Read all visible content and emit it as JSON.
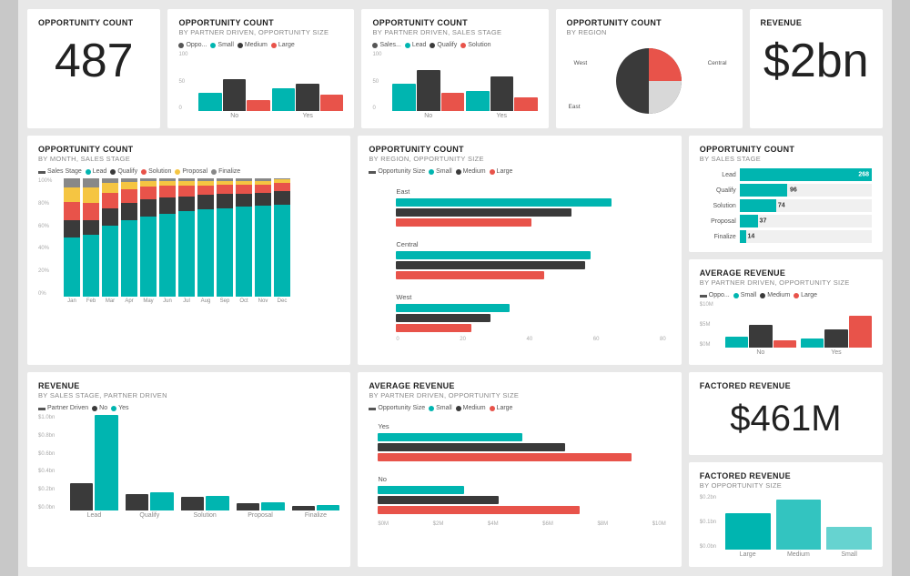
{
  "colors": {
    "teal": "#00b5b0",
    "coral": "#e8534a",
    "dark": "#3a3a3a",
    "yellow": "#f5c542",
    "gray": "#888",
    "lightgray": "#f0f0f0"
  },
  "row1": {
    "card1": {
      "title": "Opportunity Count",
      "value": "487"
    },
    "card2": {
      "title": "Opportunity Count",
      "subtitle": "BY PARTNER DRIVEN, OPPORTUNITY SIZE",
      "legend": [
        "Oppo...",
        "Small",
        "Medium",
        "Large"
      ],
      "legend_colors": [
        "#555",
        "#00b5b0",
        "#3a3a3a",
        "#e8534a"
      ]
    },
    "card3": {
      "title": "Opportunity Count",
      "subtitle": "BY PARTNER DRIVEN, SALES STAGE",
      "legend": [
        "Sales...",
        "Lead",
        "Qualify",
        "Solution"
      ],
      "legend_colors": [
        "#555",
        "#00b5b0",
        "#3a3a3a",
        "#e8534a"
      ]
    },
    "card4": {
      "title": "Opportunity Count",
      "subtitle": "BY REGION",
      "pie_labels": [
        "West",
        "Central",
        "East"
      ],
      "pie_colors": [
        "#e8534a",
        "#f0f0f0",
        "#3a3a3a"
      ]
    },
    "card5": {
      "title": "Revenue",
      "value": "$2bn"
    }
  },
  "row2": {
    "card1": {
      "title": "Opportunity Count",
      "subtitle": "BY MONTH, SALES STAGE",
      "legend": [
        "Sales Stage",
        "Lead",
        "Qualify",
        "Solution",
        "Proposal",
        "Finalize"
      ],
      "legend_colors": [
        "#555",
        "#00b5b0",
        "#3a3a3a",
        "#e8534a",
        "#f5c542",
        "#888"
      ],
      "months": [
        "Jan",
        "Feb",
        "Mar",
        "Apr",
        "May",
        "Jun",
        "Jul",
        "Aug",
        "Sep",
        "Oct",
        "Nov",
        "Dec"
      ],
      "y_labels": [
        "100%",
        "80%",
        "60%",
        "40%",
        "20%",
        "0%"
      ]
    },
    "card2": {
      "title": "Opportunity Count",
      "subtitle": "BY REGION, OPPORTUNITY SIZE",
      "legend": [
        "Opportunity Size",
        "Small",
        "Medium",
        "Large"
      ],
      "legend_colors": [
        "#555",
        "#00b5b0",
        "#3a3a3a",
        "#e8534a"
      ],
      "regions": [
        "East",
        "Central",
        "West"
      ],
      "x_labels": [
        "0",
        "20",
        "40",
        "60",
        "80"
      ]
    },
    "card3": {
      "title": "Opportunity Count",
      "subtitle": "BY SALES STAGE",
      "stages": [
        "Lead",
        "Qualify",
        "Solution",
        "Proposal",
        "Finalize"
      ],
      "values": [
        268,
        96,
        74,
        37,
        14
      ],
      "card3b": {
        "title": "Average Revenue",
        "subtitle": "BY PARTNER DRIVEN, OPPORTUNITY SIZE",
        "legend": [
          "Oppo...",
          "Small",
          "Medium",
          "Large"
        ],
        "legend_colors": [
          "#555",
          "#00b5b0",
          "#3a3a3a",
          "#e8534a"
        ],
        "y_labels": [
          "$10M",
          "$5M",
          "$0M"
        ]
      }
    }
  },
  "row3": {
    "card1": {
      "title": "Revenue",
      "subtitle": "BY SALES STAGE, PARTNER DRIVEN",
      "legend": [
        "Partner Driven",
        "No",
        "Yes"
      ],
      "legend_colors": [
        "#555",
        "#3a3a3a",
        "#00b5b0"
      ],
      "x_labels": [
        "Lead",
        "Qualify",
        "Solution",
        "Proposal",
        "Finalize"
      ],
      "y_labels": [
        "$1.0bn",
        "$0.8bn",
        "$0.6bn",
        "$0.4bn",
        "$0.2bn",
        "$0.0bn"
      ]
    },
    "card2": {
      "title": "Average Revenue",
      "subtitle": "BY PARTNER DRIVEN, OPPORTUNITY SIZE",
      "legend": [
        "Opportunity Size",
        "Small",
        "Medium",
        "Large"
      ],
      "legend_colors": [
        "#555",
        "#00b5b0",
        "#3a3a3a",
        "#e8534a"
      ],
      "groups": [
        "Yes",
        "No"
      ],
      "x_labels": [
        "$0M",
        "$2M",
        "$4M",
        "$6M",
        "$8M",
        "$10M"
      ]
    },
    "card3": {
      "title": "Factored Revenue",
      "value": "$461M",
      "card3b": {
        "title": "Factored Revenue",
        "subtitle": "BY OPPORTUNITY SIZE",
        "x_labels": [
          "Large",
          "Medium",
          "Small"
        ],
        "y_labels": [
          "$0.2bn",
          "$0.1bn",
          "$0.0bn"
        ]
      }
    }
  }
}
